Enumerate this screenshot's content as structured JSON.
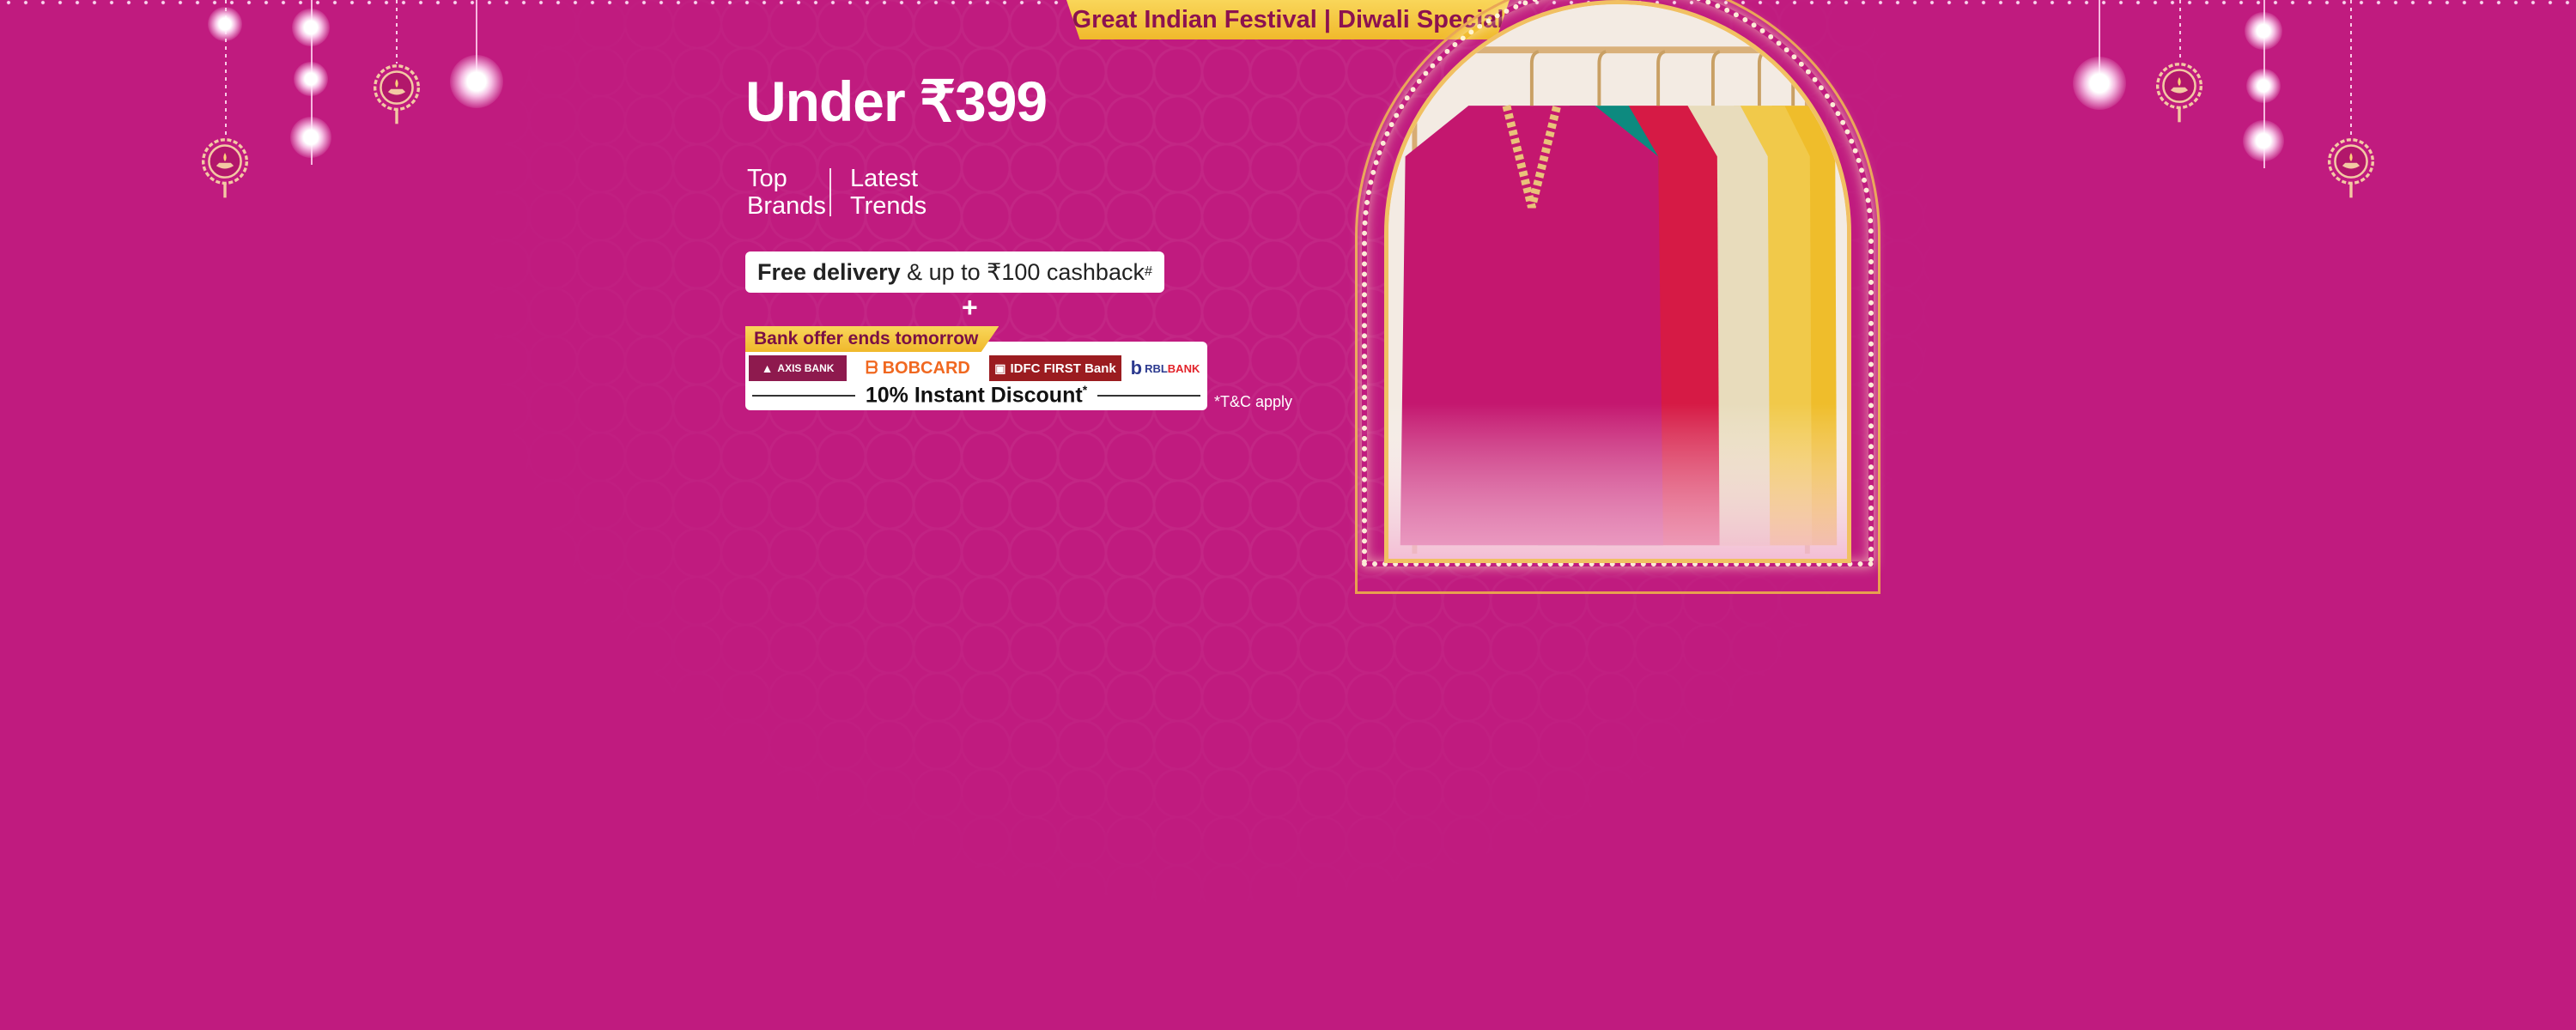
{
  "banner": {
    "festival_label": "Great Indian Festival | Diwali Special",
    "headline": "Under ₹399",
    "tags": [
      {
        "line1": "Top",
        "line2": "Brands"
      },
      {
        "line1": "Latest",
        "line2": "Trends"
      }
    ],
    "delivery": {
      "bold": "Free delivery",
      "rest": " & up to ₹100 cashback",
      "mark": "#"
    },
    "plus": "+",
    "bank_offer": {
      "tag": "Bank offer ends tomorrow",
      "banks": [
        "AXIS BANK",
        "BOBCARD",
        "IDFC FIRST Bank",
        "RBL",
        "BANK"
      ],
      "discount": "10% Instant Discount",
      "discount_mark": "*"
    },
    "tnc": "*T&C apply"
  },
  "image": {
    "subject": "festive-kurtas-on-hangers",
    "garment_colors": [
      "#c4176f",
      "#0d8a7f",
      "#d61a45",
      "#e8dcbc",
      "#f1c94a",
      "#efbd2b"
    ]
  },
  "colors": {
    "background": "#c01b7f",
    "gold": "#f0b92c",
    "festival_text": "#8c1250"
  },
  "icons": [
    "diya-lantern-icon",
    "light-bulb-icon"
  ]
}
